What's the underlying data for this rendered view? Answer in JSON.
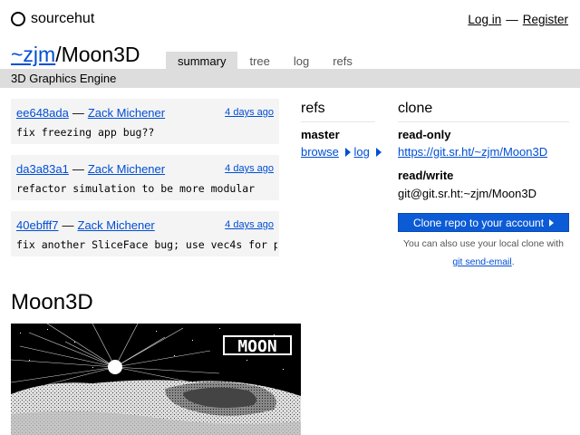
{
  "site": {
    "name": "sourcehut",
    "login": "Log in",
    "sep": "—",
    "register": "Register"
  },
  "repo": {
    "owner": "~zjm",
    "slash": "/",
    "name": "Moon3D",
    "description": "3D Graphics Engine"
  },
  "tabs": [
    {
      "label": "summary",
      "active": true
    },
    {
      "label": "tree"
    },
    {
      "label": "log"
    },
    {
      "label": "refs"
    }
  ],
  "commits": [
    {
      "hash": "ee648ada",
      "sep": "—",
      "author": "Zack Michener",
      "ago": "4 days ago",
      "message": "fix freezing app bug??"
    },
    {
      "hash": "da3a83a1",
      "sep": "—",
      "author": "Zack Michener",
      "ago": "4 days ago",
      "message": "refactor simulation to be more modular"
    },
    {
      "hash": "40ebfff7",
      "sep": "—",
      "author": "Zack Michener",
      "ago": "4 days ago",
      "message": "fix another SliceFace bug; use vec4s for p"
    }
  ],
  "refs": {
    "title": "refs",
    "branch": "master",
    "browse": "browse",
    "log": "log"
  },
  "clone": {
    "title": "clone",
    "readonly_label": "read-only",
    "readonly_url": "https://git.sr.ht/~zjm/Moon3D",
    "readwrite_label": "read/write",
    "readwrite_url": "git@git.sr.ht:~zjm/Moon3D",
    "button": "Clone repo to your account",
    "note_prefix": "You can also use your local clone with",
    "note_link": "git send-email",
    "note_suffix": "."
  },
  "readme": {
    "title": "Moon3D",
    "image_text": "MOON"
  },
  "colors": {
    "link": "#004ed5",
    "button": "#0c5bd6",
    "bar": "#dddddd",
    "commit_bg": "#f4f4f4"
  }
}
